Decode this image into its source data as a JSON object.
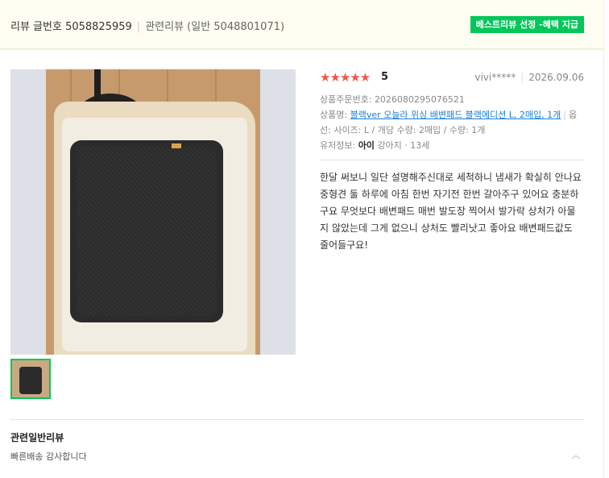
{
  "header": {
    "review_no_label": "리뷰 글번호",
    "review_no": "5058825959",
    "related_label": "관련리뷰 (일반 5048801071)",
    "best_badge": "베스트리뷰 선정 -혜택 지급"
  },
  "review": {
    "stars": "★★★★★",
    "score": "5",
    "user": "vivi*****",
    "date": "2026.09.06",
    "order_label": "상품주문번호:",
    "order_no": "2026080295076521",
    "product_label": "상품명:",
    "product_name": "블랙ver 오늘라 위싱 배변패드 블랙에디션 L, 2매입, 1개",
    "option_text": "옵션: 사이즈: L / 개당 수량: 2매입 / 수량: 1개",
    "option_prefix": "옵",
    "option_rest": "선: 사이즈: L / 개당 수량: 2매입 / 수량: 1개",
    "user_info_label": "유저정보:",
    "user_info_strong": "아이",
    "user_info_rest": "강아지 · 13세",
    "content": "한달 써보니 일단 설명해주신대로 세척하니 냄새가 확실히 안나요 중형견 둘 하루에 아침 한번 자기전 한번 갈아주구 있어요 충분하구요 무엇보다 배변패드 매번 발도장 찍어서 발가락 상처가 아물지 않았는데 그게 없으니 상처도 빨리낫고 좋아요 배변패드값도 줄어들구요!"
  },
  "related": {
    "title": "관련일반리뷰",
    "item": "빠른배송 감사합니다"
  },
  "icons": {
    "star": "star-icon",
    "chevron": "chevron-up-icon"
  },
  "colors": {
    "accent_green": "#03c75a",
    "star_red": "#f15746",
    "link_blue": "#1a7fd4"
  }
}
